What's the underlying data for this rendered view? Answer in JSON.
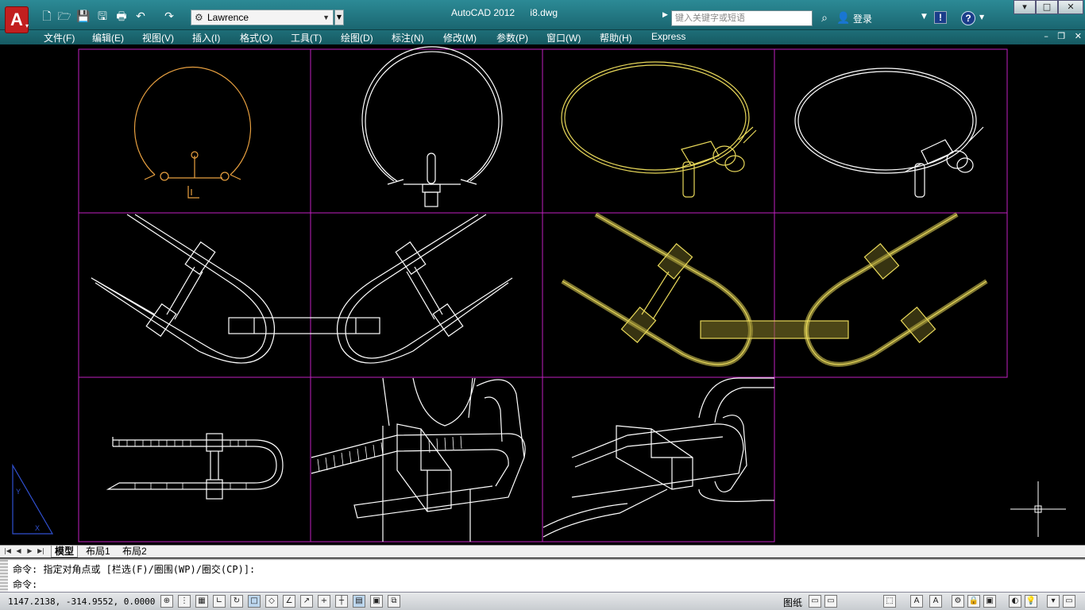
{
  "window": {
    "app_name": "AutoCAD 2012",
    "file_name": "i8.dwg",
    "controls": {
      "minimize": "▾",
      "maximize": "□",
      "close": "✕"
    }
  },
  "app_button": {
    "letter": "A",
    "arrow": "▾"
  },
  "quick_access": {
    "icons": [
      "new-icon",
      "open-icon",
      "save-icon",
      "saveas-icon",
      "plot-icon",
      "undo-icon",
      "redo-icon"
    ],
    "glyphs": [
      "🗋",
      "🗁",
      "💾",
      "🖫",
      "🖶",
      "↶",
      "↷"
    ]
  },
  "workspace": {
    "value": "Lawrence"
  },
  "search": {
    "placeholder": "键入关键字或短语"
  },
  "login": {
    "label": "登录"
  },
  "help": {
    "glyph": "?"
  },
  "exchange": {
    "glyph": "!"
  },
  "menu": {
    "items": [
      "文件(F)",
      "编辑(E)",
      "视图(V)",
      "插入(I)",
      "格式(O)",
      "工具(T)",
      "绘图(D)",
      "标注(N)",
      "修改(M)",
      "参数(P)",
      "窗口(W)",
      "帮助(H)",
      "Express"
    ]
  },
  "doc_controls": {
    "minimize": "–",
    "restore": "❐",
    "close": "✕"
  },
  "viewport": {
    "border_color": "#c020c0",
    "drawing_colors": {
      "yellow": "#e8d85a",
      "orange": "#e8a040",
      "white": "#ffffff"
    }
  },
  "layout_tabs": {
    "model": "模型",
    "layout1": "布局1",
    "layout2": "布局2",
    "nav": [
      "|◀",
      "◀",
      "▶",
      "▶|"
    ]
  },
  "command": {
    "history": "命令: 指定对角点或 [栏选(F)/圈围(WP)/圈交(CP)]:",
    "prompt": "命令:"
  },
  "status": {
    "coords": "1147.2138, -314.9552, 0.0000",
    "paper": "图纸"
  }
}
